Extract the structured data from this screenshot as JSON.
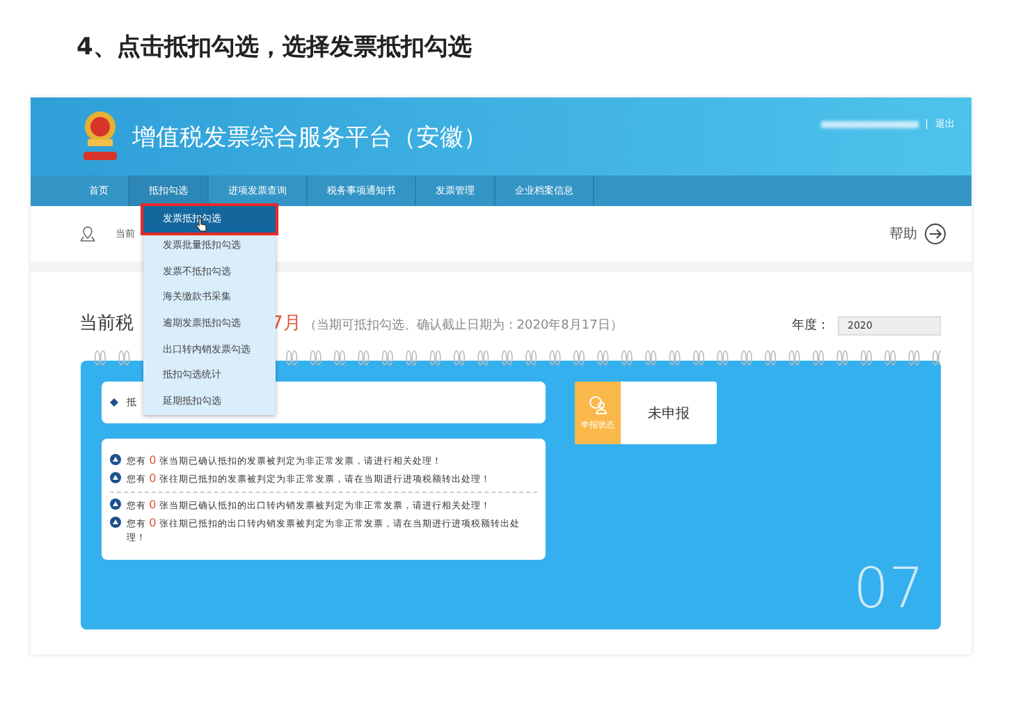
{
  "heading": "4、点击抵扣勾选，选择发票抵扣勾选",
  "header": {
    "title": "增值税发票综合服务平台（安徽）",
    "separator": "|",
    "logout": "退出"
  },
  "nav": [
    {
      "label": "首页",
      "selected": false
    },
    {
      "label": "抵扣勾选",
      "selected": true
    },
    {
      "label": "进项发票查询",
      "selected": false
    },
    {
      "label": "税务事项通知书",
      "selected": false
    },
    {
      "label": "发票管理",
      "selected": false
    },
    {
      "label": "企业档案信息",
      "selected": false
    }
  ],
  "dropdown": [
    {
      "label": "发票抵扣勾选",
      "selected": true
    },
    {
      "label": "发票批量抵扣勾选",
      "selected": false
    },
    {
      "label": "发票不抵扣勾选",
      "selected": false
    },
    {
      "label": "海关缴款书采集",
      "selected": false
    },
    {
      "label": "逾期发票抵扣勾选",
      "selected": false
    },
    {
      "label": "出口转内销发票勾选",
      "selected": false
    },
    {
      "label": "抵扣勾选统计",
      "selected": false
    },
    {
      "label": "延期抵扣勾选",
      "selected": false
    }
  ],
  "breadcrumb": "当前",
  "help": "帮助",
  "period": {
    "label": "当前税",
    "month": "7月",
    "note": "（当期可抵扣勾选、确认截止日期为：2020年8月17日）"
  },
  "year": {
    "label": "年度：",
    "value": "2020"
  },
  "summary": "抵",
  "notice_groups": [
    [
      {
        "prefix": "您有",
        "count": "0",
        "text": "张当期已确认抵扣的发票被判定为非正常发票，请进行相关处理！"
      },
      {
        "prefix": "您有",
        "count": "0",
        "text": "张往期已抵扣的发票被判定为非正常发票，请在当期进行进项税额转出处理！"
      }
    ],
    [
      {
        "prefix": "您有",
        "count": "0",
        "text": "张当期已确认抵扣的出口转内销发票被判定为非正常发票，请进行相关处理！"
      },
      {
        "prefix": "您有",
        "count": "0",
        "text": "张往期已抵扣的出口转内销发票被判定为非正常发票，请在当期进行进项税额转出处理！"
      }
    ]
  ],
  "status": {
    "label": "申报状态",
    "value": "未申报"
  },
  "month_number": "07"
}
